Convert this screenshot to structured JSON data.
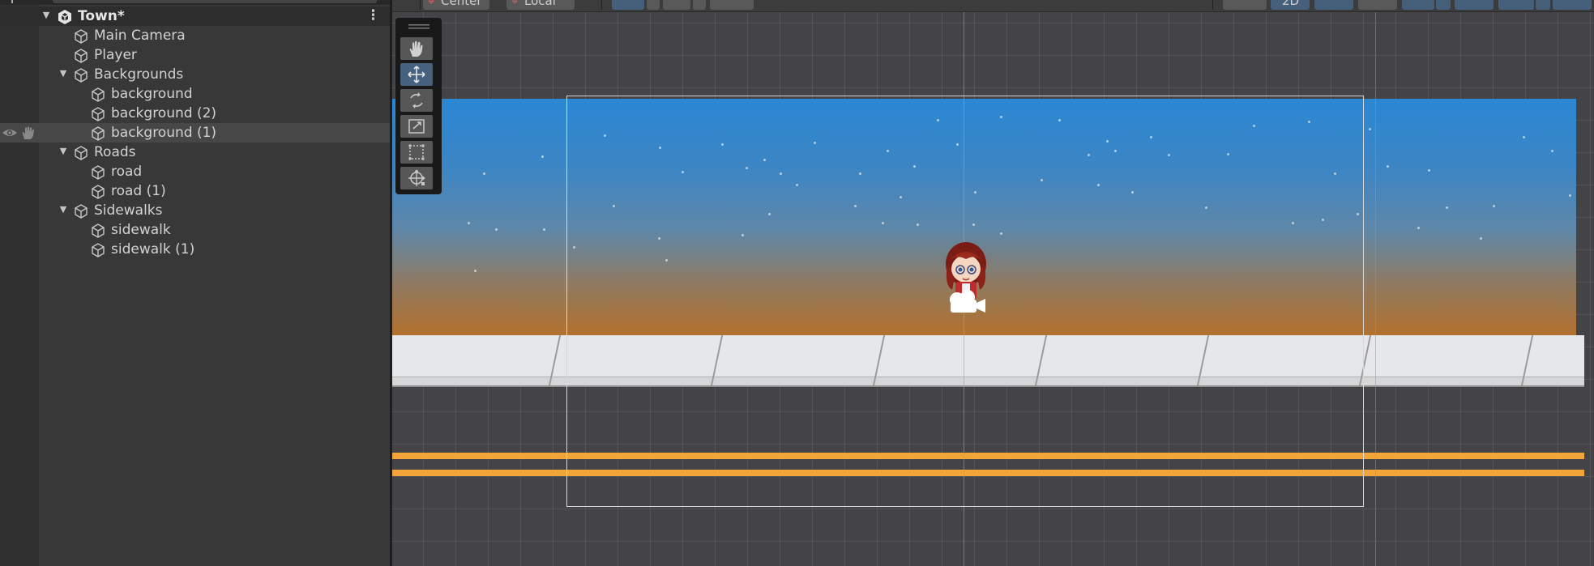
{
  "hierarchy": {
    "scene_name": "Town*",
    "items": [
      {
        "label": "Main Camera",
        "depth": 1,
        "icon": "gameobject-cube-icon"
      },
      {
        "label": "Player",
        "depth": 1,
        "icon": "gameobject-cube-icon"
      },
      {
        "label": "Backgrounds",
        "depth": 1,
        "icon": "gameobject-cube-icon",
        "expanded": true
      },
      {
        "label": "background",
        "depth": 2,
        "icon": "gameobject-cube-icon"
      },
      {
        "label": "background (2)",
        "depth": 2,
        "icon": "gameobject-cube-icon"
      },
      {
        "label": "background (1)",
        "depth": 2,
        "icon": "gameobject-cube-icon",
        "selected": true
      },
      {
        "label": "Roads",
        "depth": 1,
        "icon": "gameobject-cube-icon",
        "expanded": true
      },
      {
        "label": "road",
        "depth": 2,
        "icon": "gameobject-cube-icon"
      },
      {
        "label": "road (1)",
        "depth": 2,
        "icon": "gameobject-cube-icon"
      },
      {
        "label": "Sidewalks",
        "depth": 1,
        "icon": "gameobject-cube-icon",
        "expanded": true
      },
      {
        "label": "sidewalk",
        "depth": 2,
        "icon": "gameobject-cube-icon"
      },
      {
        "label": "sidewalk (1)",
        "depth": 2,
        "icon": "gameobject-cube-icon"
      }
    ]
  },
  "scene_toolbar": {
    "pivot_mode": "Center",
    "pivot_rotation": "Local",
    "mode_2d": "2D"
  },
  "tools": [
    "hand-tool",
    "move-tool",
    "rotate-tool",
    "scale-tool",
    "rect-tool",
    "transform-tool"
  ],
  "active_tool": "move-tool",
  "colors": {
    "sky_top": "#2a87d3",
    "sky_bottom": "#b2712e",
    "road_line": "#f2a63a",
    "sidewalk": "#e6e7e9",
    "selection": "#474747",
    "active_tool": "#45617e"
  }
}
